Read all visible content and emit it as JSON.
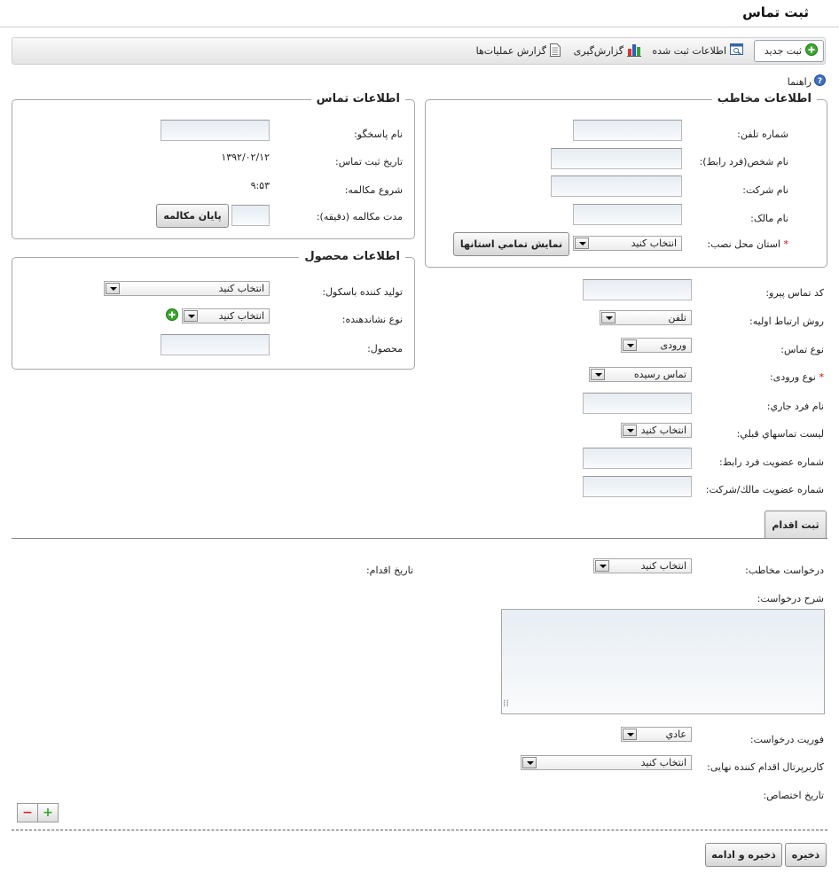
{
  "page": {
    "title": "ثبت تماس"
  },
  "toolbar": {
    "new_record": "ثبت جديد",
    "recorded_info": "اطلاعات ثبت شده",
    "reporting": "گزارش‌گیری",
    "operations_report": "گزارش عملیات‌ها"
  },
  "help": {
    "label": "راهنما"
  },
  "caller_info": {
    "legend": "اطلاعات مخاطب",
    "phone_label": "شماره تلفن:",
    "person_name_label": "نام شخص(فرد رابط):",
    "company_label": "نام شرکت:",
    "owner_label": "نام مالک:",
    "province_label": "استان محل نصب:",
    "province_value": "انتخاب کنید",
    "show_all_provinces": "نمايش تمامي استانها",
    "required_mark": "*"
  },
  "contact_info": {
    "legend": "اطلاعات تماس",
    "responder_label": "نام پاسخگو:",
    "date_label": "تاریخ ثبت تماس:",
    "date_value": "۱۳۹۲/۰۲/۱۲",
    "start_label": "شروع مکالمه:",
    "start_value": "۹:۵۳",
    "duration_label": "مدت مکالمه (دقیقه):",
    "end_call": "پایان مکالمه"
  },
  "product_info": {
    "legend": "اطلاعات محصول",
    "manufacturer_label": "تولید کننده باسکول:",
    "manufacturer_value": "انتخاب کنید",
    "indicator_label": "نوع نشاندهنده:",
    "indicator_value": "انتخاب کنید",
    "product_label": "محصول:"
  },
  "followup": {
    "code_label": "کد تماس پیرو:",
    "method_label": "روش ارتباط اولیه:",
    "method_value": "تلفن",
    "contact_type_label": "نوع تماس:",
    "contact_type_value": "ورودی",
    "input_type_label": "نوع ورودی:",
    "input_type_value": "تماس رسیده",
    "current_person_label": "نام فرد جاري:",
    "prev_contacts_label": "لیست تماسهاي قبلي:",
    "prev_contacts_value": "انتخاب کنید",
    "member_no_label": "شماره عضویت فرد رابط:",
    "owner_member_no_label": "شماره عضویت مالك/شركت:",
    "required_mark": "*"
  },
  "action": {
    "tab_label": "ثبت اقدام",
    "request_label": "درخواست مخاطب:",
    "request_value": "انتخاب کنید",
    "action_date_label": "تاریخ اقدام:",
    "description_label": "شرح درخواست:",
    "urgency_label": "فوریت درخواست:",
    "urgency_value": "عادي",
    "final_user_label": "کاربرپرتال اقدام کننده نهایی:",
    "final_user_value": "انتخاب کنید",
    "assign_date_label": "تاریخ اختصاص:"
  },
  "footer": {
    "save": "ذخيره",
    "save_continue": "ذخيره و ادامه"
  },
  "colors": {
    "add_green": "#3aa62f",
    "remove_red": "#d42a2a",
    "required": "#dd0000"
  }
}
